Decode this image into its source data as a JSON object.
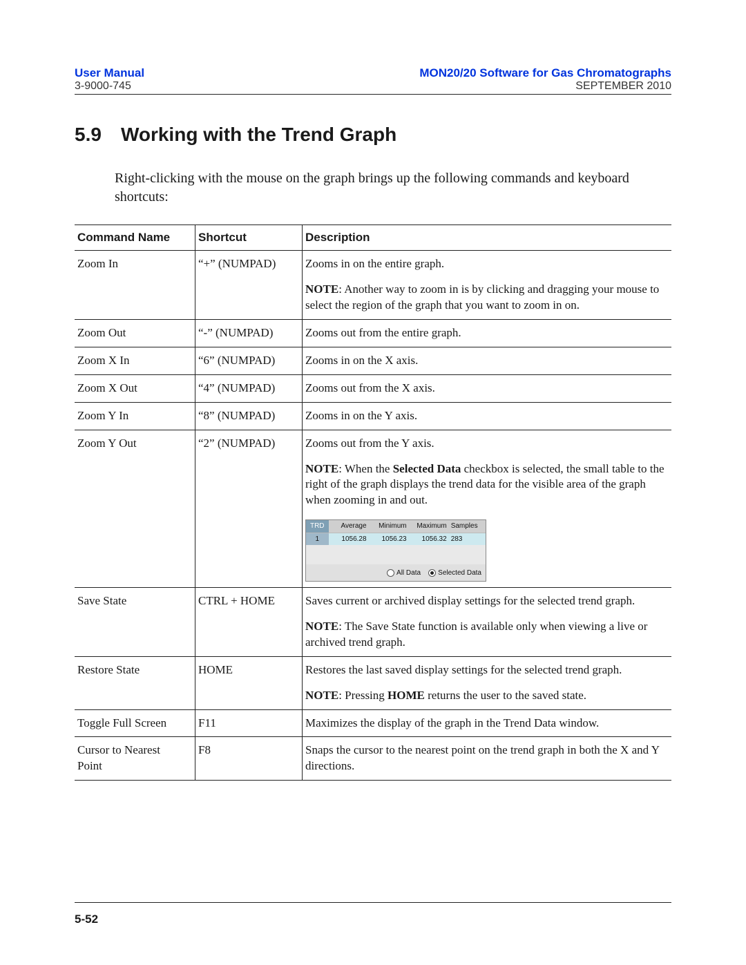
{
  "header": {
    "left_title": "User Manual",
    "left_sub": "3-9000-745",
    "right_title": "MON20/20 Software for Gas Chromatographs",
    "right_sub": "SEPTEMBER 2010"
  },
  "section": {
    "number": "5.9",
    "title": "Working with the Trend Graph",
    "intro": "Right-clicking with the mouse on the graph brings up the following commands and keyboard shortcuts:"
  },
  "table": {
    "headers": {
      "name": "Command Name",
      "shortcut": "Shortcut",
      "desc": "Description"
    },
    "rows": [
      {
        "name": "Zoom In",
        "shortcut": "“+” (NUMPAD)",
        "desc": "Zooms in on the entire graph.",
        "note_label": "NOTE",
        "note": ": Another way to zoom in is by clicking and dragging your mouse to select the region of the graph that you want to zoom in on."
      },
      {
        "name": "Zoom Out",
        "shortcut": "“-” (NUMPAD)",
        "desc": "Zooms out from the entire graph."
      },
      {
        "name": "Zoom X In",
        "shortcut": "“6” (NUMPAD)",
        "desc": "Zooms in on the X axis."
      },
      {
        "name": "Zoom X Out",
        "shortcut": "“4” (NUMPAD)",
        "desc": "Zooms out from the X axis."
      },
      {
        "name": "Zoom Y In",
        "shortcut": "“8” (NUMPAD)",
        "desc": "Zooms in on the Y axis."
      },
      {
        "name": "Zoom Y Out",
        "shortcut": "“2” (NUMPAD)",
        "desc": "Zooms out from the Y axis.",
        "note_label": "NOTE",
        "note_pre": ": When the ",
        "note_bold": "Selected Data",
        "note_post": " checkbox is selected, the small table to the right of the graph displays the trend data for the visible area of the graph when zooming in and out.",
        "has_mini": true
      },
      {
        "name": "Save State",
        "shortcut": "CTRL + HOME",
        "desc": "Saves current or archived display settings for the selected trend graph.",
        "note_label": "NOTE",
        "note": ": The Save State function is available only when viewing a live or archived trend graph."
      },
      {
        "name": "Restore State",
        "shortcut": "HOME",
        "desc": "Restores the last saved display settings for the selected trend graph.",
        "note_label": "NOTE",
        "note_pre": ": Pressing ",
        "note_bold": "HOME",
        "note_post": " returns the user to the saved state."
      },
      {
        "name": "Toggle Full Screen",
        "shortcut": "F11",
        "desc": "Maximizes the display of the graph in the Trend Data window."
      },
      {
        "name": "Cursor to Nearest Point",
        "shortcut": "F8",
        "desc": "Snaps the cursor to the nearest point on the trend graph in both the X and Y directions."
      }
    ]
  },
  "mini_table": {
    "headers": [
      "TRD",
      "Average",
      "Minimum",
      "Maximum",
      "Samples"
    ],
    "row": [
      "1",
      "1056.28",
      "1056.23",
      "1056.32",
      "283"
    ],
    "opt_all": "All Data",
    "opt_sel": "Selected Data"
  },
  "footer": {
    "page": "5-52"
  }
}
